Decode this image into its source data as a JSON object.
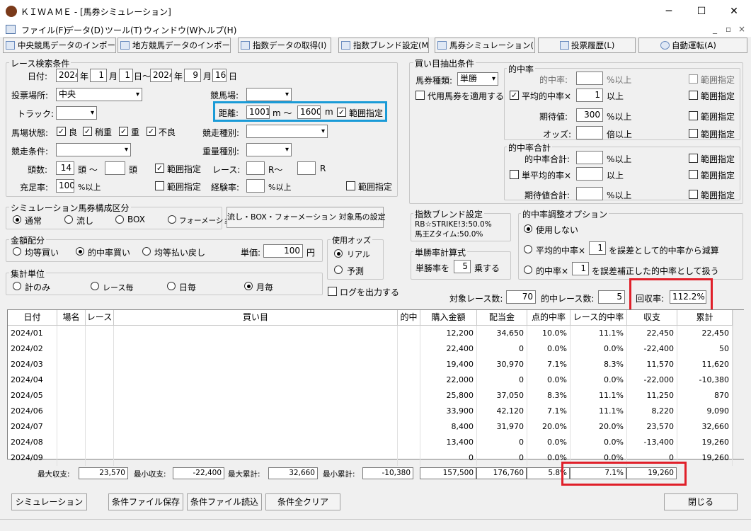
{
  "window": {
    "title": "ＫＩＷＡＭＥ - [馬券シミュレーション]",
    "minimize": "─",
    "maximize": "☐",
    "close": "✕"
  },
  "menu": [
    "ファイル(F)",
    "データ(D)",
    "ツール(T)",
    "ウィンドウ(W)",
    "ヘルプ(H)"
  ],
  "mdi": {
    "min": "_",
    "restore": "▫",
    "close": "×"
  },
  "toolbar": [
    "中央競馬データのインポート(J)",
    "地方競馬データのインポート(N)",
    "指数データの取得(I)",
    "指数ブレンド設定(M)",
    "馬券シミュレーション(B)",
    "投票履歴(L)",
    "自動運転(A)"
  ],
  "race": {
    "title": "レース検索条件",
    "date_label": "日付:",
    "from_year": "2024",
    "from_month": "1",
    "from_day": "1",
    "to_year": "2024",
    "to_month": "9",
    "to_day": "16",
    "u_year": "年",
    "u_month": "月",
    "u_day_tilde": "日〜",
    "u_day": "日",
    "venue_label": "投票場所:",
    "venue_value": "中央",
    "course_label": "競馬場:",
    "course_value": "",
    "track_label": "トラック:",
    "track_value": "",
    "dist_label": "距離:",
    "dist_from": "1001",
    "dist_unit1": "m 〜",
    "dist_to": "1600",
    "dist_unit2": "m",
    "dist_range": "範囲指定",
    "cond_label": "馬場状態:",
    "cond": [
      "良",
      "稍重",
      "重",
      "不良"
    ],
    "race_type_label": "競走種別:",
    "race_type_value": "",
    "race_cond_label": "競走条件:",
    "race_cond_value": "",
    "weight_label": "重量種別:",
    "weight_value": "",
    "heads_label": "頭数:",
    "heads_from": "14",
    "heads_unit1": "頭 〜",
    "heads_to": "",
    "heads_unit2": "頭",
    "heads_range": "範囲指定",
    "race_no_label": "レース:",
    "race_from": "",
    "race_unit1": "R〜",
    "race_to": "",
    "race_unit2": "R",
    "fill_label": "充足率:",
    "fill_value": "100",
    "fill_unit": "%以上",
    "fill_range": "範囲指定",
    "exp_label": "経験率:",
    "exp_value": "",
    "exp_unit": "%以上",
    "exp_range": "範囲指定"
  },
  "sim": {
    "title": "シミュレーション馬券構成区分",
    "options": [
      "通常",
      "流し",
      "BOX",
      "フォーメーション"
    ],
    "set_button": "流し・BOX・フォーメーション 対象馬の設定"
  },
  "money": {
    "title": "金額配分",
    "options": [
      "均等買い",
      "的中率買い",
      "均等払い戻し"
    ],
    "unit_label": "単価:",
    "unit_value": "100",
    "unit_suffix": "円"
  },
  "odds": {
    "title": "使用オッズ",
    "options": [
      "リアル",
      "予測"
    ]
  },
  "agg": {
    "title": "集計単位",
    "options": [
      "計のみ",
      "レース毎",
      "日毎",
      "月毎"
    ]
  },
  "log_label": "ログを出力する",
  "buy": {
    "title": "買い目抽出条件",
    "kind_label": "馬券種類:",
    "kind_value": "単勝",
    "substitute": "代用馬券を適用する",
    "hit_title": "的中率",
    "hit_label": "的中率:",
    "hit_value": "",
    "hit_unit": "%以上",
    "avg_hit_label": "平均的中率×",
    "avg_hit_value": "1",
    "avg_hit_unit": "以上",
    "ev_label": "期待値:",
    "ev_value": "300",
    "ev_unit": "%以上",
    "odds_label": "オッズ:",
    "odds_value": "",
    "odds_unit": "倍以上",
    "sum_title": "的中率合計",
    "sum_label": "的中率合計:",
    "sum_value": "",
    "sum_unit": "%以上",
    "single_avg_label": "単平均的率×",
    "single_avg_value": "",
    "single_avg_unit": "以上",
    "ev_sum_label": "期待値合計:",
    "ev_sum_value": "",
    "ev_sum_unit": "%以上",
    "range": "範囲指定"
  },
  "blend": {
    "title": "指数ブレンド設定",
    "line1": "RB☆STRIKE!3:50.0%",
    "line2": "馬王Zタイム:50.0%"
  },
  "win": {
    "title": "単勝率計算式",
    "label": "単勝率を",
    "value": "5",
    "unit": "乗する"
  },
  "adjust": {
    "title": "的中率調整オプション",
    "opt1": "使用しない",
    "opt2_pre": "平均的中率×",
    "opt2_val": "1",
    "opt2_post": "を誤差として的中率から減算",
    "opt3_pre": "的中率×",
    "opt3_val": "1",
    "opt3_post": "を誤差補正した的中率として扱う"
  },
  "stats": {
    "target_label": "対象レース数:",
    "target_value": "70",
    "hit_label": "的中レース数:",
    "hit_value": "5",
    "return_label": "回収率:",
    "return_value": "112.2%"
  },
  "table": {
    "headers": [
      "日付",
      "場名",
      "レース",
      "買い目",
      "的中",
      "購入金額",
      "配当金",
      "点的中率",
      "レース的中率",
      "収支",
      "累計"
    ],
    "rows": [
      [
        "2024/01",
        "",
        "",
        "",
        "",
        "12,200",
        "34,650",
        "10.0%",
        "11.1%",
        "22,450",
        "22,450"
      ],
      [
        "2024/02",
        "",
        "",
        "",
        "",
        "22,400",
        "0",
        "0.0%",
        "0.0%",
        "-22,400",
        "50"
      ],
      [
        "2024/03",
        "",
        "",
        "",
        "",
        "19,400",
        "30,970",
        "7.1%",
        "8.3%",
        "11,570",
        "11,620"
      ],
      [
        "2024/04",
        "",
        "",
        "",
        "",
        "22,000",
        "0",
        "0.0%",
        "0.0%",
        "-22,000",
        "-10,380"
      ],
      [
        "2024/05",
        "",
        "",
        "",
        "",
        "25,800",
        "37,050",
        "8.3%",
        "11.1%",
        "11,250",
        "870"
      ],
      [
        "2024/06",
        "",
        "",
        "",
        "",
        "33,900",
        "42,120",
        "7.1%",
        "11.1%",
        "8,220",
        "9,090"
      ],
      [
        "2024/07",
        "",
        "",
        "",
        "",
        "8,400",
        "31,970",
        "20.0%",
        "20.0%",
        "23,570",
        "32,660"
      ],
      [
        "2024/08",
        "",
        "",
        "",
        "",
        "13,400",
        "0",
        "0.0%",
        "0.0%",
        "-13,400",
        "19,260"
      ],
      [
        "2024/09",
        "",
        "",
        "",
        "",
        "0",
        "0",
        "0.0%",
        "0.0%",
        "0",
        "19,260"
      ]
    ]
  },
  "footer": {
    "max_income_label": "最大収支:",
    "max_income": "23,570",
    "min_income_label": "最小収支:",
    "min_income": "-22,400",
    "max_cum_label": "最大累計:",
    "max_cum": "32,660",
    "min_cum_label": "最小累計:",
    "min_cum": "-10,380",
    "total_buy": "157,500",
    "total_pay": "176,760",
    "total_point": "5.8%",
    "total_race": "7.1%",
    "total_income": "19,260"
  },
  "buttons": {
    "simulate": "シミュレーション",
    "save": "条件ファイル保存",
    "load": "条件ファイル読込",
    "clear": "条件全クリア",
    "close": "閉じる"
  },
  "colors": {
    "highlight_blue": "#1a9bd7",
    "highlight_red": "#e0202a"
  }
}
